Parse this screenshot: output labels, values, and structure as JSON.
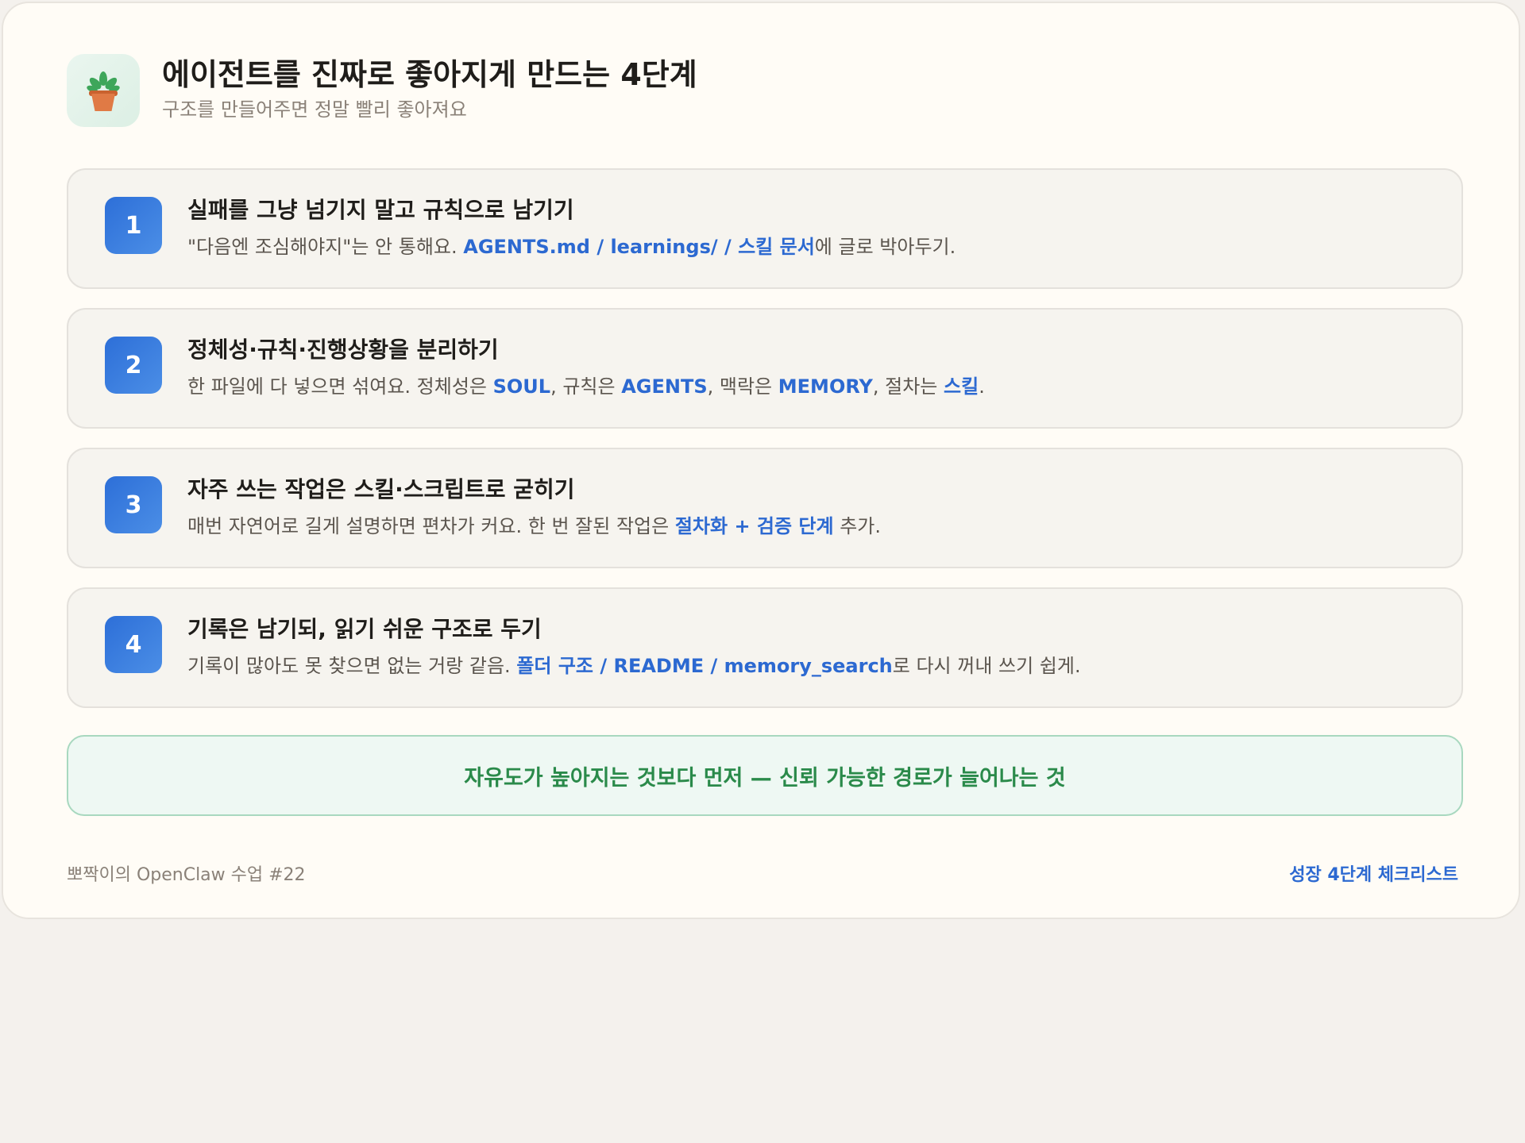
{
  "header": {
    "icon": "potted-plant-icon",
    "title": "에이전트를 진짜로 좋아지게 만드는 4단계",
    "subtitle": "구조를 만들어주면 정말 빨리 좋아져요"
  },
  "steps": [
    {
      "number": "1",
      "title": "실패를 그냥 넘기지 말고 규칙으로 남기기",
      "desc": [
        {
          "text": "\"다음엔 조심해야지\"는 안 통해요. ",
          "hl": false
        },
        {
          "text": "AGENTS.md / learnings/ / 스킬 문서",
          "hl": true
        },
        {
          "text": "에 글로 박아두기.",
          "hl": false
        }
      ]
    },
    {
      "number": "2",
      "title": "정체성·규칙·진행상황을 분리하기",
      "desc": [
        {
          "text": "한 파일에 다 넣으면 섞여요. 정체성은 ",
          "hl": false
        },
        {
          "text": "SOUL",
          "hl": true
        },
        {
          "text": ", 규칙은 ",
          "hl": false
        },
        {
          "text": "AGENTS",
          "hl": true
        },
        {
          "text": ", 맥락은 ",
          "hl": false
        },
        {
          "text": "MEMORY",
          "hl": true
        },
        {
          "text": ", 절차는 ",
          "hl": false
        },
        {
          "text": "스킬",
          "hl": true
        },
        {
          "text": ".",
          "hl": false
        }
      ]
    },
    {
      "number": "3",
      "title": "자주 쓰는 작업은 스킬·스크립트로 굳히기",
      "desc": [
        {
          "text": "매번 자연어로 길게 설명하면 편차가 커요. 한 번 잘된 작업은 ",
          "hl": false
        },
        {
          "text": "절차화 + 검증 단계",
          "hl": true
        },
        {
          "text": " 추가.",
          "hl": false
        }
      ]
    },
    {
      "number": "4",
      "title": "기록은 남기되, 읽기 쉬운 구조로 두기",
      "desc": [
        {
          "text": "기록이 많아도 못 찾으면 없는 거랑 같음. ",
          "hl": false
        },
        {
          "text": "폴더 구조 / README / memory_search",
          "hl": true
        },
        {
          "text": "로 다시 꺼내 쓰기 쉽게.",
          "hl": false
        }
      ]
    }
  ],
  "banner": {
    "text": "자유도가 높아지는 것보다 먼저 — 신뢰 가능한 경로가 늘어나는 것"
  },
  "footer": {
    "left": "뽀짝이의 OpenClaw 수업 #22",
    "right": "성장 4단계 체크리스트"
  },
  "colors": {
    "accent": "#2c69d1",
    "banner_text": "#2a8a4a",
    "background": "#fffcf6"
  }
}
